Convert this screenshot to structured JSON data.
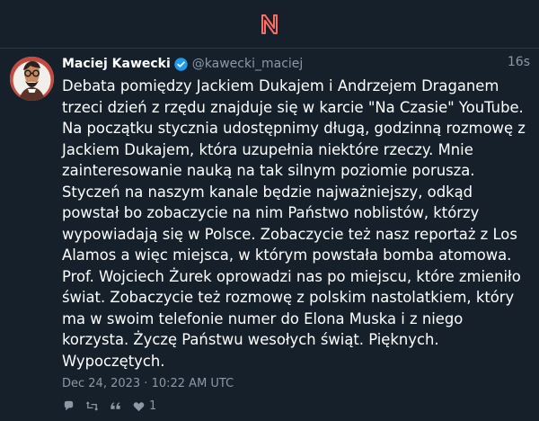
{
  "post": {
    "author_name": "Maciej Kawecki",
    "author_handle": "@kawecki_maciej",
    "timestamp_relative": "16s",
    "body": "Debata pomiędzy Jackiem Dukajem i Andrzejem Draganem trzeci dzień z rzędu znajduje się w karcie \"Na Czasie\" YouTube. Na początku stycznia udostępnimy długą, godzinną rozmowę z Jackiem Dukajem, która uzupełnia niektóre rzeczy. Mnie zainteresowanie nauką na tak silnym poziomie porusza. Styczeń na naszym kanale będzie najważniejszy, odkąd powstał bo zobaczycie na nim Państwo noblistów, którzy wypowiadają się w Polsce. Zobaczycie też nasz reportaż z Los Alamos a więc miejsca, w którym powstała bomba atomowa. Prof. Wojciech Żurek oprowadzi nas po miejscu, które zmieniło świat. Zobaczycie też rozmowę z polskim nastolatkiem, który ma w swoim telefonie numer do Elona Muska i z niego korzysta. Życzę Państwu wesołych świąt. Pięknych. Wypoczętych.",
    "posted_at": "Dec 24, 2023 · 10:22 AM UTC",
    "like_count": "1"
  },
  "icons": {
    "logo": "nitter-logo",
    "verified": "verified-badge-icon",
    "reply": "reply-icon",
    "retweet": "retweet-icon",
    "quote": "quote-icon",
    "like": "heart-icon"
  },
  "colors": {
    "background": "#15202b",
    "accent": "#ff6c60",
    "text": "#ffffff",
    "muted": "#8b98a5",
    "verified": "#1d9bf0",
    "divider": "#2a3743"
  }
}
